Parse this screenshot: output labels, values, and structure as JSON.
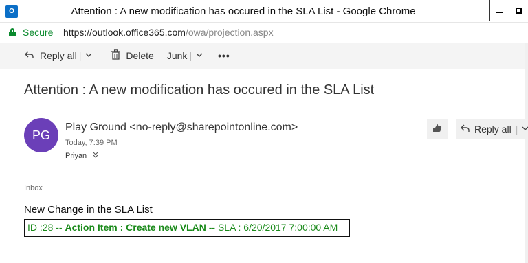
{
  "window": {
    "title": "Attention : A new modification has occured in the SLA List - Google Chrome",
    "app_icon_text": "O"
  },
  "address_bar": {
    "secure_label": "Secure",
    "url_host": "https://outlook.office365.com",
    "url_path": "/owa/projection.aspx"
  },
  "toolbar": {
    "reply_all_label": "Reply all",
    "delete_label": "Delete",
    "junk_label": "Junk",
    "more_label": "•••"
  },
  "message": {
    "subject": "Attention : A new modification has occured in the SLA List",
    "avatar_initials": "PG",
    "sender": "Play Ground <no-reply@sharepointonline.com>",
    "sent_time": "Today, 7:39 PM",
    "recipient": "Priyan",
    "reply_all_label": "Reply all",
    "folder": "Inbox",
    "body_heading": "New Change in the SLA List",
    "body_line": {
      "id_part": "ID :28 -- ",
      "action_part": "Action Item : Create new VLAN",
      "sla_part": " -- SLA : 6/20/2017 7:00:00 AM"
    }
  },
  "colors": {
    "avatar": "#6b3fb8",
    "secure_green": "#0b8a2e",
    "body_text_green": "#1a8a1a",
    "toolbar_bg": "#f4f4f4"
  }
}
